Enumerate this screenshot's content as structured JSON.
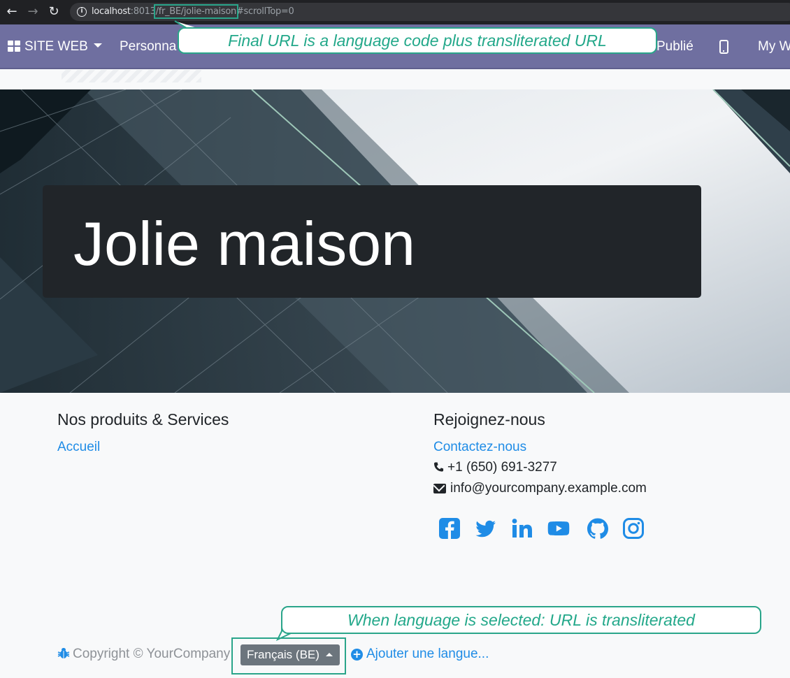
{
  "browser": {
    "url_host": "localhost",
    "url_port": ":8013",
    "url_path": "/fr_BE/jolie-maison",
    "url_hash": "#scrollTop=0"
  },
  "topbar": {
    "site_menu": "SITE WEB",
    "personalize": "Personna",
    "published": "Publié",
    "my_website": "My W"
  },
  "callouts": {
    "url_note": "Final URL is a language code plus transliterated URL",
    "lang_note": "When language is selected: URL is transliterated"
  },
  "hero": {
    "title": "Jolie maison"
  },
  "footer": {
    "left_title": "Nos produits & Services",
    "left_links": [
      "Accueil"
    ],
    "right_title": "Rejoignez-nous",
    "contact_link": "Contactez-nous",
    "phone": "+1 (650) 691-3277",
    "email": "info@yourcompany.example.com",
    "social_icons": [
      "facebook-icon",
      "twitter-icon",
      "linkedin-icon",
      "youtube-icon",
      "github-icon",
      "instagram-icon"
    ]
  },
  "bottom": {
    "copyright": "Copyright © YourCompany",
    "language": "Français (BE)",
    "add_language": "Ajouter une langue..."
  },
  "colors": {
    "accent_link": "#1f8ce6",
    "topbar": "#6f6fa0",
    "callout": "#2aa58a"
  }
}
